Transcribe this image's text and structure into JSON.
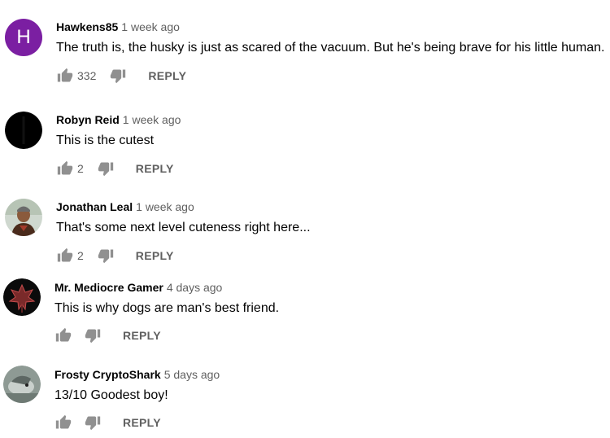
{
  "comments": [
    {
      "author": "Hawkens85",
      "time": "1 week ago",
      "text": "The truth is, the husky is just as scared of the vacuum. But he's being brave for his little human.",
      "likes": "332",
      "reply_label": "REPLY",
      "avatar_letter": "H",
      "avatar_color": "#7b1fa2"
    },
    {
      "author": "Robyn Reid",
      "time": "1 week ago",
      "text": "This is the cutest",
      "likes": "2",
      "reply_label": "REPLY",
      "avatar_color": "#000000"
    },
    {
      "author": "Jonathan Leal",
      "time": "1 week ago",
      "text": "That's some next level cuteness right here...",
      "likes": "2",
      "reply_label": "REPLY"
    },
    {
      "author": "Mr. Mediocre Gamer",
      "time": "4 days ago",
      "text": "This is why dogs are man's best friend.",
      "likes": "",
      "reply_label": "REPLY"
    },
    {
      "author": "Frosty CryptoShark",
      "time": "5 days ago",
      "text": "13/10  Goodest boy!",
      "likes": "",
      "reply_label": "REPLY"
    }
  ],
  "icons": {
    "like": "thumb-up-icon",
    "dislike": "thumb-down-icon"
  }
}
